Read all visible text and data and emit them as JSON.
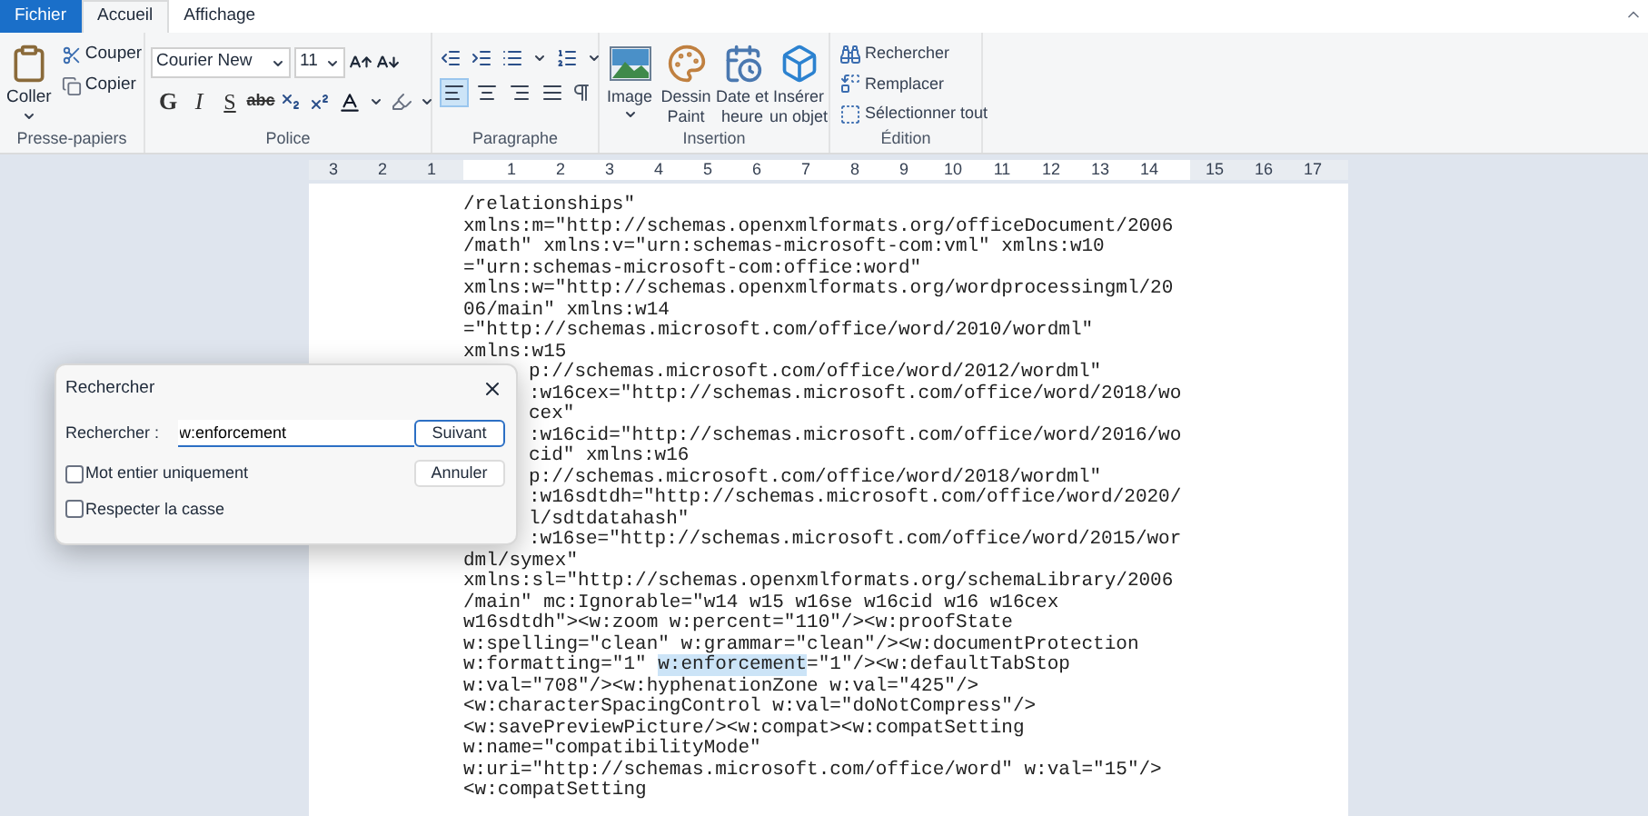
{
  "menu_tabs": [
    {
      "label": "Fichier",
      "kind": "file",
      "selected": false
    },
    {
      "label": "Accueil",
      "kind": "tab",
      "selected": true
    },
    {
      "label": "Affichage",
      "kind": "tab",
      "selected": false
    }
  ],
  "ribbon": {
    "clipboard": {
      "label": "Presse-papiers",
      "paste": "Coller",
      "cut": "Couper",
      "copy": "Copier"
    },
    "font": {
      "label": "Police",
      "family": "Courier New",
      "size": "11",
      "format_buttons": [
        {
          "label": "G",
          "kind": "bold"
        },
        {
          "label": "I",
          "kind": "italic"
        },
        {
          "label": "S",
          "kind": "underline"
        },
        {
          "label": "abc",
          "kind": "strike"
        }
      ]
    },
    "paragraph": {
      "label": "Paragraphe",
      "alignments": [
        {
          "kind": "left",
          "selected": true
        },
        {
          "kind": "center",
          "selected": false
        },
        {
          "kind": "right",
          "selected": false
        },
        {
          "kind": "justify",
          "selected": false
        }
      ]
    },
    "insertion": {
      "label": "Insertion",
      "items": [
        {
          "label": "Image",
          "kind": "image"
        },
        {
          "label": "Dessin Paint",
          "kind": "paint"
        },
        {
          "label": "Date et heure",
          "kind": "date"
        },
        {
          "label": "Insérer un objet",
          "kind": "object"
        }
      ]
    },
    "edition": {
      "label": "Édition",
      "items": [
        {
          "label": "Rechercher",
          "kind": "find"
        },
        {
          "label": "Remplacer",
          "kind": "replace"
        },
        {
          "label": "Sélectionner tout",
          "kind": "select_all"
        }
      ]
    }
  },
  "ruler": {
    "left_numbers": [
      "3",
      "2",
      "1"
    ],
    "numbers": [
      "1",
      "2",
      "3",
      "4",
      "5",
      "6",
      "7",
      "8",
      "9",
      "10",
      "11",
      "12",
      "13",
      "14"
    ],
    "right_numbers": [
      "15",
      "16",
      "17"
    ]
  },
  "document": {
    "lines": [
      {
        "text": "/relationships\""
      },
      {
        "text": "xmlns:m=\"http://schemas.openxmlformats.org/officeDocument/2006"
      },
      {
        "text": "/math\" xmlns:v=\"urn:schemas-microsoft-com:vml\" xmlns:w10"
      },
      {
        "text": "=\"urn:schemas-microsoft-com:office:word\""
      },
      {
        "text": "xmlns:w=\"http://schemas.openxmlformats.org/wordprocessingml/20"
      },
      {
        "text": "06/main\" xmlns:w14"
      },
      {
        "text": "=\"http://schemas.microsoft.com/office/word/2010/wordml\""
      },
      {
        "text": "xmlns:w15"
      }
    ],
    "lines_behind_dialog": [
      {
        "text": "p://schemas.microsoft.com/office/word/2012/wordml\""
      },
      {
        "text": ":w16cex=\"http://schemas.microsoft.com/office/word/2018/wo"
      },
      {
        "text": "cex\""
      },
      {
        "text": ":w16cid=\"http://schemas.microsoft.com/office/word/2016/wo"
      },
      {
        "text": "cid\" xmlns:w16"
      },
      {
        "text": "p://schemas.microsoft.com/office/word/2018/wordml\""
      },
      {
        "text": ":w16sdtdh=\"http://schemas.microsoft.com/office/word/2020/"
      },
      {
        "text": "l/sdtdatahash\""
      },
      {
        "text": ":w16se=\"http://schemas.microsoft.com/office/word/2015/wor"
      }
    ],
    "lines_after": [
      {
        "text": "dml/symex\""
      },
      {
        "text": "xmlns:sl=\"http://schemas.openxmlformats.org/schemaLibrary/2006"
      },
      {
        "text": "/main\" mc:Ignorable=\"w14 w15 w16se w16cid w16 w16cex"
      },
      {
        "text": "w16sdtdh\"><w:zoom w:percent=\"110\"/><w:proofState"
      },
      {
        "text": "w:spelling=\"clean\" w:grammar=\"clean\"/><w:documentProtection"
      },
      {
        "parts": [
          {
            "text": "w:formatting=\"1\" ",
            "highlighted": false
          },
          {
            "text": "w:enforcement",
            "highlighted": true
          },
          {
            "text": "=\"1\"/><w:defaultTabStop",
            "highlighted": false
          }
        ]
      },
      {
        "text": "w:val=\"708\"/><w:hyphenationZone w:val=\"425\"/>"
      },
      {
        "text": "<w:characterSpacingControl w:val=\"doNotCompress\"/>"
      },
      {
        "text": "<w:savePreviewPicture/><w:compat><w:compatSetting"
      },
      {
        "text": "w:name=\"compatibilityMode\""
      },
      {
        "text": "w:uri=\"http://schemas.microsoft.com/office/word\" w:val=\"15\"/>"
      },
      {
        "text": "<w:compatSetting"
      }
    ]
  },
  "find_dialog": {
    "title": "Rechercher",
    "label": "Rechercher :",
    "value": "w:enforcement",
    "buttons": [
      {
        "label": "Suivant",
        "default": true
      },
      {
        "label": "Annuler",
        "default": false
      }
    ],
    "options": [
      {
        "label": "Mot entier uniquement",
        "checked": false
      },
      {
        "label": "Respecter la casse",
        "checked": false
      }
    ]
  }
}
